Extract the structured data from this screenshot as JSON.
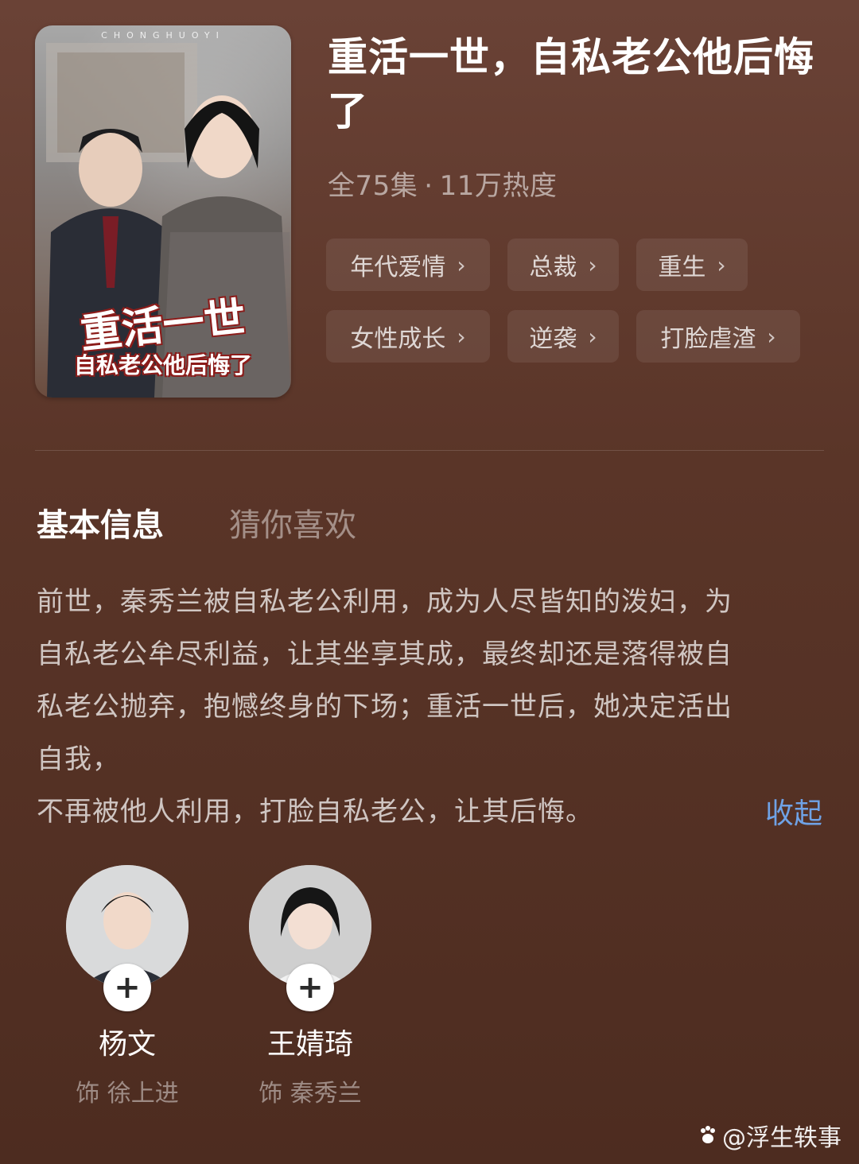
{
  "poster": {
    "brand_text": "CHONGHUOYI",
    "title_main": "重活一世",
    "title_sub": "自私老公他后悔了"
  },
  "drama": {
    "title": "重活一世，自私老公他后悔了",
    "episodes": "全75集",
    "popularity": "11万热度",
    "separator": "·"
  },
  "tags": [
    {
      "label": "年代爱情"
    },
    {
      "label": "总裁"
    },
    {
      "label": "重生"
    },
    {
      "label": "女性成长"
    },
    {
      "label": "逆袭"
    },
    {
      "label": "打脸虐渣"
    }
  ],
  "tabs": {
    "basic_info": "基本信息",
    "guess_you_like": "猜你喜欢"
  },
  "description": {
    "line1": "前世，秦秀兰被自私老公利用，成为人尽皆知的泼妇，为",
    "line2": "自私老公牟尽利益，让其坐享其成，最终却还是落得被自",
    "line3": "私老公抛弃，抱憾终身的下场；重活一世后，她决定活出",
    "line4": "自我，",
    "line5": "不再被他人利用，打脸自私老公，让其后悔。",
    "collapse_label": "收起"
  },
  "cast": [
    {
      "name": "杨文",
      "role": "饰 徐上进"
    },
    {
      "name": "王婧琦",
      "role": "饰 秦秀兰"
    }
  ],
  "icons": {
    "tag_chevron": "chevron-right-icon",
    "follow": "plus-icon",
    "watermark": "paw-icon"
  },
  "watermark": {
    "text": "@浮生轶事"
  },
  "colors": {
    "background_top": "#6a4236",
    "background_bottom": "#4d2c20",
    "link": "#6fa2e6"
  }
}
